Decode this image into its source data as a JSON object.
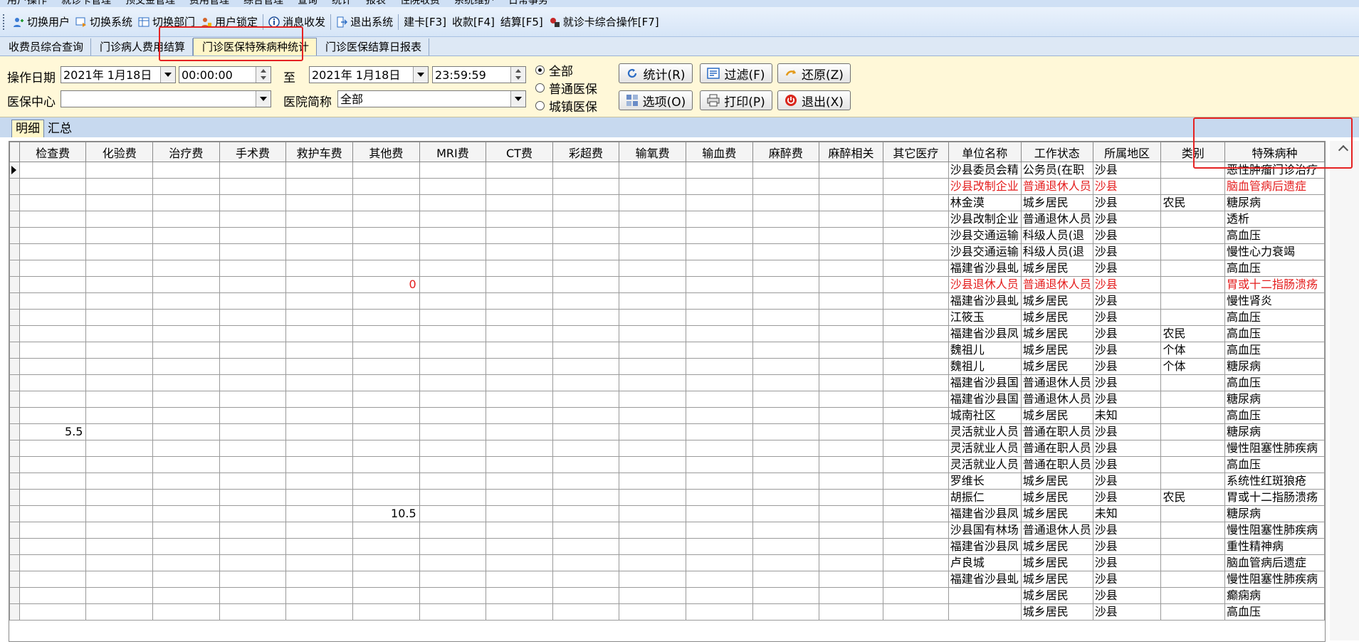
{
  "menu": {
    "items": [
      "用户操作",
      "就诊卡管理",
      "预交金管理",
      "费用管理",
      "综合管理",
      "查询",
      "统计",
      "报表",
      "住院收费",
      "系统维护",
      "日常事务"
    ]
  },
  "toolbar": {
    "items": [
      {
        "label": "切换用户",
        "icon": "switch-user-icon"
      },
      {
        "label": "切换系统",
        "icon": "switch-system-icon"
      },
      {
        "label": "切换部门",
        "icon": "switch-department-icon"
      },
      {
        "label": "用户锁定",
        "icon": "user-lock-icon"
      },
      {
        "label": "消息收发",
        "icon": "info-icon"
      },
      {
        "label": "退出系统",
        "icon": "exit-system-icon"
      },
      {
        "label": "建卡[F3]"
      },
      {
        "label": "收款[F4]"
      },
      {
        "label": "结算[F5]"
      },
      {
        "label": "就诊卡综合操作[F7]",
        "icon": "card-operation-icon"
      }
    ]
  },
  "tabs": [
    "收费员综合查询",
    "门诊病人费用结算",
    "门诊医保特殊病种统计",
    "门诊医保结算日报表"
  ],
  "active_tab": 2,
  "filter": {
    "date_label": "操作日期",
    "start_date": "2021年 1月18日",
    "start_time": "00:00:00",
    "to_label": "至",
    "end_date": "2021年 1月18日",
    "end_time": "23:59:59",
    "center_label": "医保中心",
    "center_value": "",
    "hospital_label": "医院简称",
    "hospital_value": "全部",
    "radios": [
      "全部",
      "普通医保",
      "城镇医保"
    ],
    "selected_radio": 0
  },
  "buttons": {
    "stat": "统计(R)",
    "filter": "过滤(F)",
    "restore": "还原(Z)",
    "options": "选项(O)",
    "print": "打印(P)",
    "exit": "退出(X)"
  },
  "subtabs": [
    "明细",
    "汇总"
  ],
  "table": {
    "columns": [
      "检查费",
      "化验费",
      "治疗费",
      "手术费",
      "救护车费",
      "其他费",
      "MRI费",
      "CT费",
      "彩超费",
      "输氧费",
      "输血费",
      "麻醉费",
      "麻醉相关",
      "其它医疗",
      "单位名称",
      "工作状态",
      "所属地区",
      "类别",
      "特殊病种"
    ],
    "rows": [
      {
        "cells": [
          "",
          "",
          "",
          "",
          "",
          "",
          "",
          "",
          "",
          "",
          "",
          "",
          "",
          "",
          "沙县委员会精",
          "公务员(在职",
          "沙县",
          "",
          "恶性肿瘤门诊治疗"
        ],
        "highlight": false,
        "current": true
      },
      {
        "cells": [
          "",
          "",
          "",
          "",
          "",
          "",
          "",
          "",
          "",
          "",
          "",
          "",
          "",
          "",
          "沙县改制企业",
          "普通退休人员",
          "沙县",
          "",
          "脑血管病后遗症"
        ],
        "highlight": true
      },
      {
        "cells": [
          "",
          "",
          "",
          "",
          "",
          "",
          "",
          "",
          "",
          "",
          "",
          "",
          "",
          "",
          "林金漠",
          "城乡居民",
          "沙县",
          "农民",
          "糖尿病"
        ],
        "highlight": false
      },
      {
        "cells": [
          "",
          "",
          "",
          "",
          "",
          "",
          "",
          "",
          "",
          "",
          "",
          "",
          "",
          "",
          "沙县改制企业",
          "普通退休人员",
          "沙县",
          "",
          "透析"
        ],
        "highlight": false
      },
      {
        "cells": [
          "",
          "",
          "",
          "",
          "",
          "",
          "",
          "",
          "",
          "",
          "",
          "",
          "",
          "",
          "沙县交通运输",
          "科级人员(退",
          "沙县",
          "",
          "高血压"
        ],
        "highlight": false
      },
      {
        "cells": [
          "",
          "",
          "",
          "",
          "",
          "",
          "",
          "",
          "",
          "",
          "",
          "",
          "",
          "",
          "沙县交通运输",
          "科级人员(退",
          "沙县",
          "",
          "慢性心力衰竭"
        ],
        "highlight": false
      },
      {
        "cells": [
          "",
          "",
          "",
          "",
          "",
          "",
          "",
          "",
          "",
          "",
          "",
          "",
          "",
          "",
          "福建省沙县虬",
          "城乡居民",
          "沙县",
          "",
          "高血压"
        ],
        "highlight": false
      },
      {
        "cells": [
          "",
          "",
          "",
          "",
          "",
          "0",
          "",
          "",
          "",
          "",
          "",
          "",
          "",
          "",
          "沙县退休人员",
          "普通退休人员",
          "沙县",
          "",
          "胃或十二指肠溃疡"
        ],
        "highlight": true
      },
      {
        "cells": [
          "",
          "",
          "",
          "",
          "",
          "",
          "",
          "",
          "",
          "",
          "",
          "",
          "",
          "",
          "福建省沙县虬",
          "城乡居民",
          "沙县",
          "",
          "慢性肾炎"
        ],
        "highlight": false
      },
      {
        "cells": [
          "",
          "",
          "",
          "",
          "",
          "",
          "",
          "",
          "",
          "",
          "",
          "",
          "",
          "",
          "江筱玉",
          "城乡居民",
          "沙县",
          "",
          "高血压"
        ],
        "highlight": false
      },
      {
        "cells": [
          "",
          "",
          "",
          "",
          "",
          "",
          "",
          "",
          "",
          "",
          "",
          "",
          "",
          "",
          "福建省沙县凤",
          "城乡居民",
          "沙县",
          "农民",
          "高血压"
        ],
        "highlight": false
      },
      {
        "cells": [
          "",
          "",
          "",
          "",
          "",
          "",
          "",
          "",
          "",
          "",
          "",
          "",
          "",
          "",
          "魏祖儿",
          "城乡居民",
          "沙县",
          "个体",
          "高血压"
        ],
        "highlight": false
      },
      {
        "cells": [
          "",
          "",
          "",
          "",
          "",
          "",
          "",
          "",
          "",
          "",
          "",
          "",
          "",
          "",
          "魏祖儿",
          "城乡居民",
          "沙县",
          "个体",
          "糖尿病"
        ],
        "highlight": false
      },
      {
        "cells": [
          "",
          "",
          "",
          "",
          "",
          "",
          "",
          "",
          "",
          "",
          "",
          "",
          "",
          "",
          "福建省沙县国",
          "普通退休人员",
          "沙县",
          "",
          "高血压"
        ],
        "highlight": false
      },
      {
        "cells": [
          "",
          "",
          "",
          "",
          "",
          "",
          "",
          "",
          "",
          "",
          "",
          "",
          "",
          "",
          "福建省沙县国",
          "普通退休人员",
          "沙县",
          "",
          "糖尿病"
        ],
        "highlight": false
      },
      {
        "cells": [
          "",
          "",
          "",
          "",
          "",
          "",
          "",
          "",
          "",
          "",
          "",
          "",
          "",
          "",
          "城南社区",
          "城乡居民",
          "未知",
          "",
          "高血压"
        ],
        "highlight": false
      },
      {
        "cells": [
          "5.5",
          "",
          "",
          "",
          "",
          "",
          "",
          "",
          "",
          "",
          "",
          "",
          "",
          "",
          "灵活就业人员",
          "普通在职人员",
          "沙县",
          "",
          "糖尿病"
        ],
        "highlight": false
      },
      {
        "cells": [
          "",
          "",
          "",
          "",
          "",
          "",
          "",
          "",
          "",
          "",
          "",
          "",
          "",
          "",
          "灵活就业人员",
          "普通在职人员",
          "沙县",
          "",
          "慢性阻塞性肺疾病"
        ],
        "highlight": false
      },
      {
        "cells": [
          "",
          "",
          "",
          "",
          "",
          "",
          "",
          "",
          "",
          "",
          "",
          "",
          "",
          "",
          "灵活就业人员",
          "普通在职人员",
          "沙县",
          "",
          "高血压"
        ],
        "highlight": false
      },
      {
        "cells": [
          "",
          "",
          "",
          "",
          "",
          "",
          "",
          "",
          "",
          "",
          "",
          "",
          "",
          "",
          "罗维长",
          "城乡居民",
          "沙县",
          "",
          "系统性红斑狼疮"
        ],
        "highlight": false
      },
      {
        "cells": [
          "",
          "",
          "",
          "",
          "",
          "",
          "",
          "",
          "",
          "",
          "",
          "",
          "",
          "",
          "胡振仁",
          "城乡居民",
          "沙县",
          "农民",
          "胃或十二指肠溃疡"
        ],
        "highlight": false
      },
      {
        "cells": [
          "",
          "",
          "",
          "",
          "",
          "10.5",
          "",
          "",
          "",
          "",
          "",
          "",
          "",
          "",
          "福建省沙县凤",
          "城乡居民",
          "未知",
          "",
          "糖尿病"
        ],
        "highlight": false
      },
      {
        "cells": [
          "",
          "",
          "",
          "",
          "",
          "",
          "",
          "",
          "",
          "",
          "",
          "",
          "",
          "",
          "沙县国有林场",
          "普通退休人员",
          "沙县",
          "",
          "慢性阻塞性肺疾病"
        ],
        "highlight": false
      },
      {
        "cells": [
          "",
          "",
          "",
          "",
          "",
          "",
          "",
          "",
          "",
          "",
          "",
          "",
          "",
          "",
          "福建省沙县凤",
          "城乡居民",
          "沙县",
          "",
          "重性精神病"
        ],
        "highlight": false
      },
      {
        "cells": [
          "",
          "",
          "",
          "",
          "",
          "",
          "",
          "",
          "",
          "",
          "",
          "",
          "",
          "",
          "卢良城",
          "城乡居民",
          "沙县",
          "",
          "脑血管病后遗症"
        ],
        "highlight": false
      },
      {
        "cells": [
          "",
          "",
          "",
          "",
          "",
          "",
          "",
          "",
          "",
          "",
          "",
          "",
          "",
          "",
          "福建省沙县虬",
          "城乡居民",
          "沙县",
          "",
          "慢性阻塞性肺疾病"
        ],
        "highlight": false
      },
      {
        "cells": [
          "",
          "",
          "",
          "",
          "",
          "",
          "",
          "",
          "",
          "",
          "",
          "",
          "",
          "",
          "",
          "城乡居民",
          "沙县",
          "",
          "癫痫病"
        ],
        "highlight": false
      },
      {
        "cells": [
          "",
          "",
          "",
          "",
          "",
          "",
          "",
          "",
          "",
          "",
          "",
          "",
          "",
          "",
          "",
          "城乡居民",
          "沙县",
          "",
          "高血压"
        ],
        "highlight": false
      }
    ]
  },
  "colors": {
    "highlight_text": "#e41c1c",
    "annotation_box": "#e52222",
    "filter_bg": "#fff8d8"
  }
}
